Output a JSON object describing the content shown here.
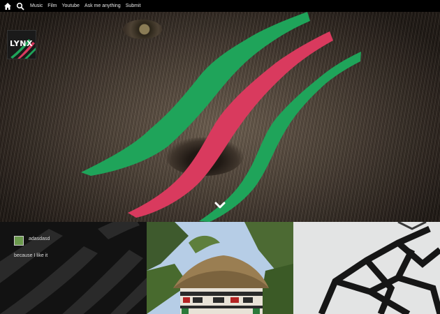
{
  "topbar": {
    "home_icon": "home-icon",
    "search_icon": "search-icon",
    "nav": [
      "Music",
      "Film",
      "Youtube",
      "Ask me anything",
      "Submit"
    ]
  },
  "hero": {
    "logo_text": "LYNX",
    "scroll_icon": "chevron-down-icon",
    "colors": {
      "green": "#1fa45a",
      "red": "#d93a5e"
    }
  },
  "posts": [
    {
      "username": "adasdasd",
      "caption": "because I like it"
    }
  ]
}
